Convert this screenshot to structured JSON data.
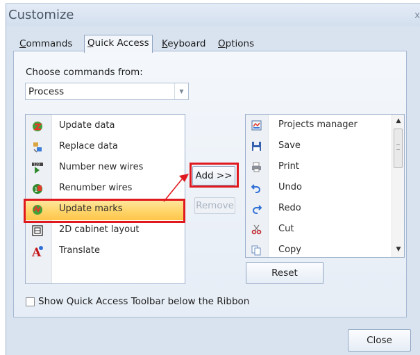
{
  "window": {
    "title": "Customize",
    "close_glyph": "x"
  },
  "tabs": [
    {
      "label_u": "C",
      "label_rest": "ommands",
      "active": false
    },
    {
      "label_u": "Q",
      "label_rest": "uick Access",
      "active": true
    },
    {
      "label_u": "K",
      "label_rest": "eyboard",
      "active": false
    },
    {
      "label_u": "O",
      "label_rest": "ptions",
      "active": false
    }
  ],
  "choose": {
    "label": "Choose commands from:",
    "selected": "Process"
  },
  "available_commands": [
    {
      "label": "Update data",
      "icon": "update-data-icon"
    },
    {
      "label": "Replace data",
      "icon": "replace-data-icon"
    },
    {
      "label": "Number new wires",
      "icon": "number-wires-icon"
    },
    {
      "label": "Renumber wires",
      "icon": "renumber-wires-icon"
    },
    {
      "label": "Update marks",
      "icon": "update-marks-icon",
      "selected": true
    },
    {
      "label": "2D cabinet layout",
      "icon": "cabinet-layout-icon"
    },
    {
      "label": "Translate",
      "icon": "translate-icon"
    }
  ],
  "toolbar_commands": [
    {
      "label": "Projects manager",
      "icon": "projects-manager-icon"
    },
    {
      "label": "Save",
      "icon": "save-icon"
    },
    {
      "label": "Print",
      "icon": "print-icon"
    },
    {
      "label": "Undo",
      "icon": "undo-icon"
    },
    {
      "label": "Redo",
      "icon": "redo-icon"
    },
    {
      "label": "Cut",
      "icon": "cut-icon"
    },
    {
      "label": "Copy",
      "icon": "copy-icon"
    }
  ],
  "buttons": {
    "add": "Add >>",
    "remove": "Remove",
    "reset": "Reset",
    "close": "Close"
  },
  "checkbox": {
    "label": "Show Quick Access Toolbar below the Ribbon",
    "checked": false
  },
  "colors": {
    "annotation_red": "#e0191f",
    "selection": "#ffd56b"
  }
}
